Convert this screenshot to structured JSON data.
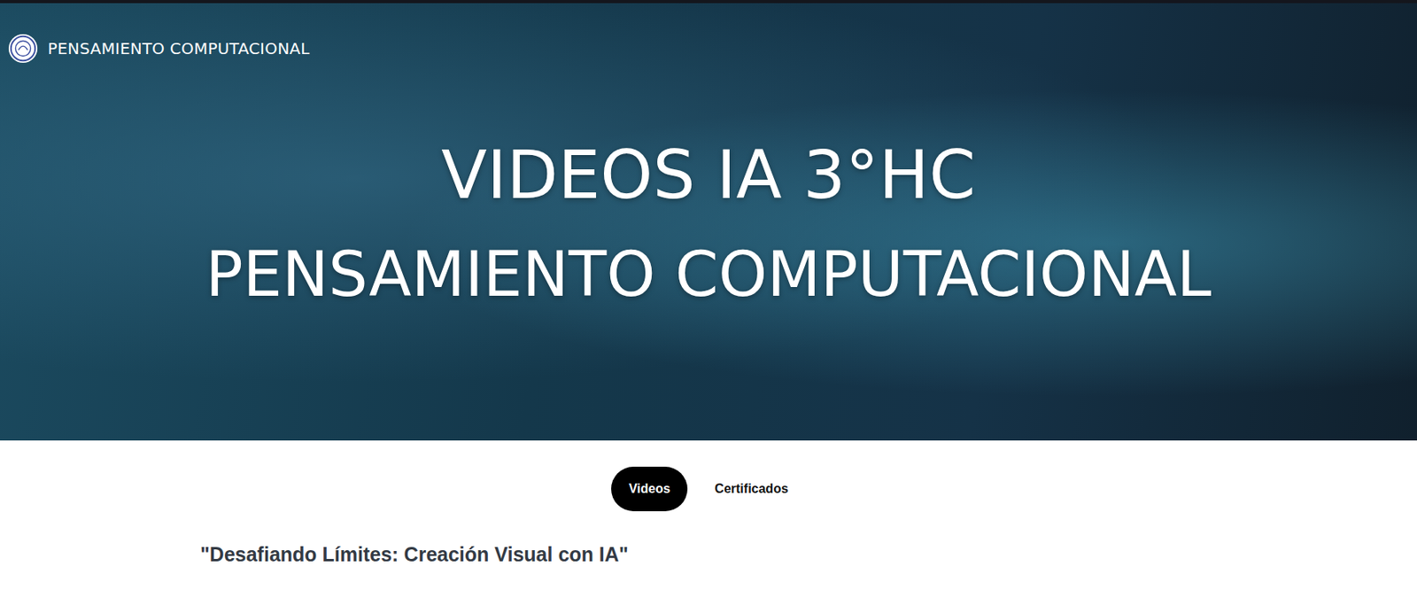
{
  "header": {
    "site_name": "PENSAMIENTO COMPUTACIONAL"
  },
  "hero": {
    "title_lines": [
      "VIDEOS IA 3°HC",
      "PENSAMIENTO COMPUTACIONAL"
    ]
  },
  "tabs": [
    {
      "label": "Videos",
      "selected": true
    },
    {
      "label": "Certificados",
      "selected": false
    }
  ],
  "section": {
    "heading": "\"Desafiando Límites: Creación Visual con IA\""
  }
}
